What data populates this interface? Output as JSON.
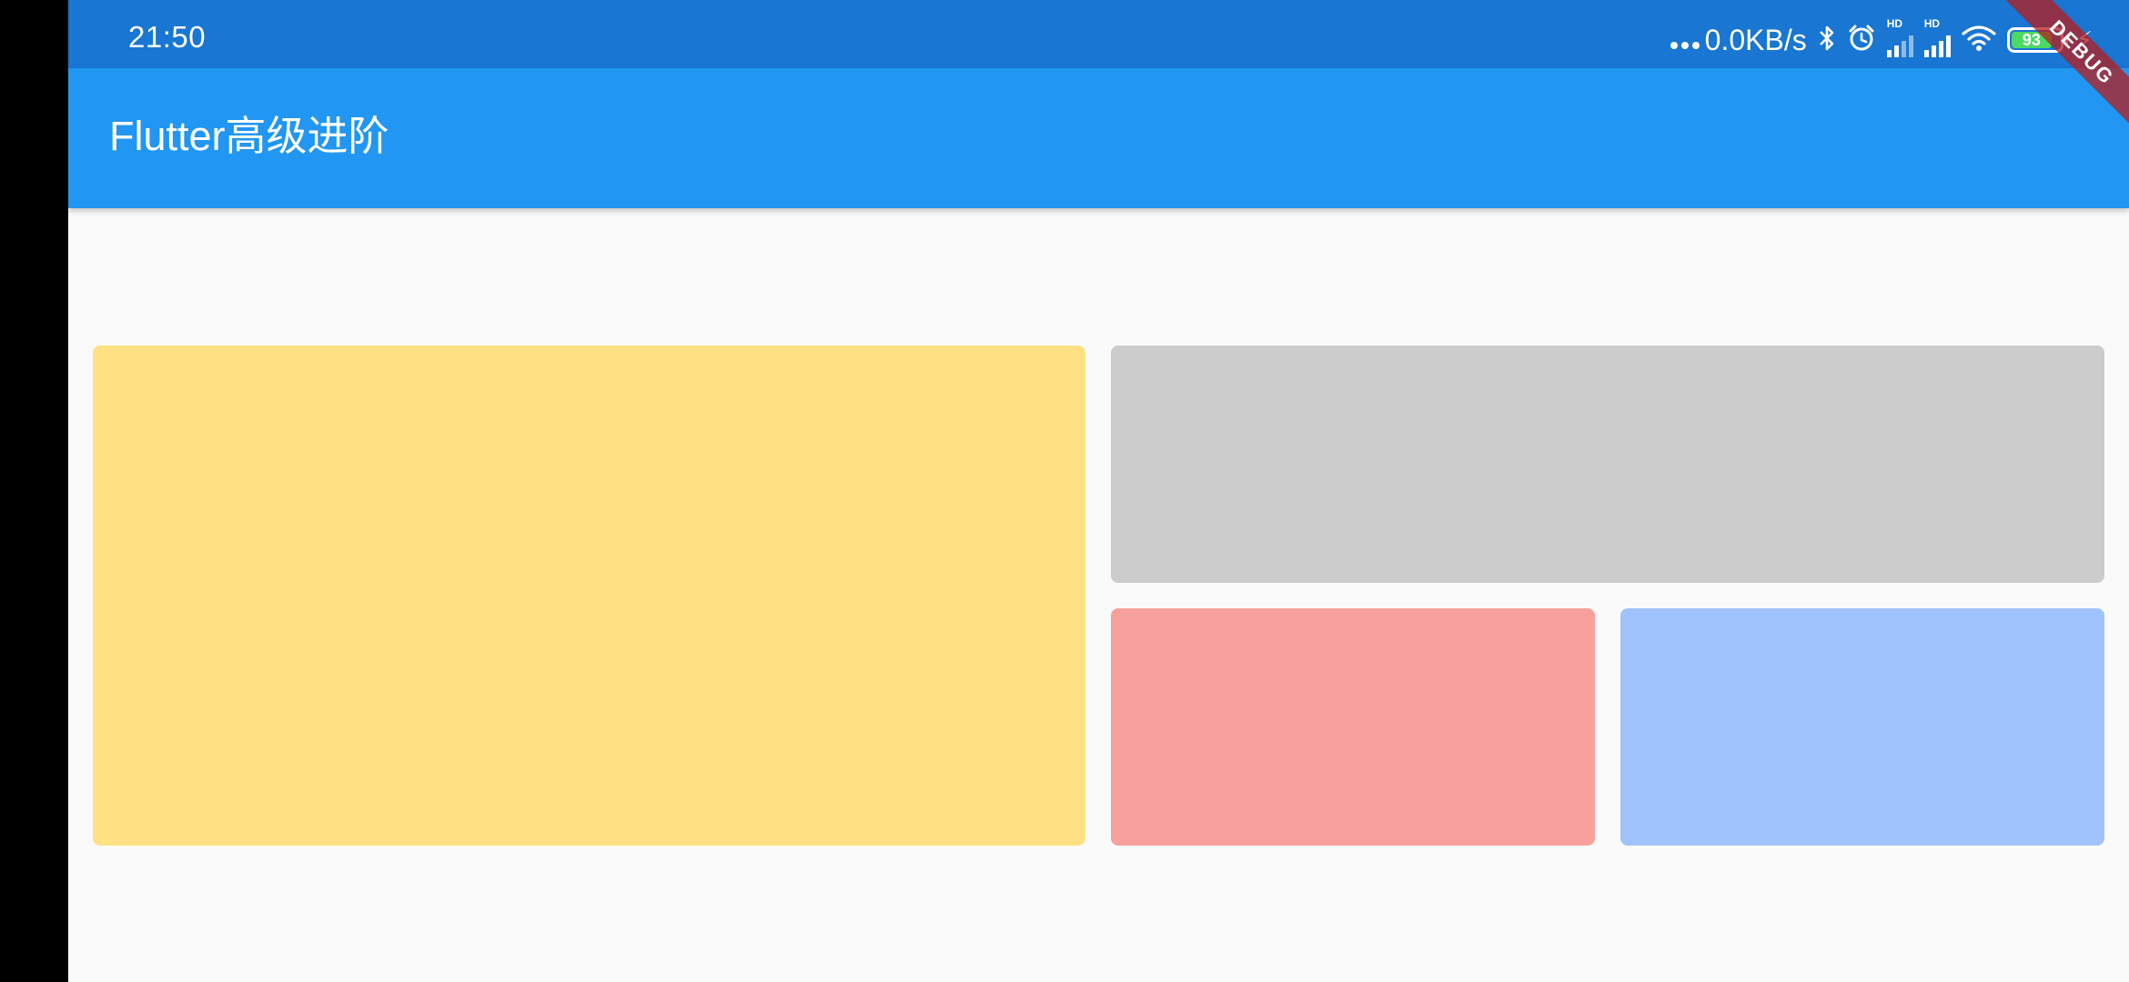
{
  "status_bar": {
    "time": "21:50",
    "network_speed": "0.0KB/s",
    "sim1_label": "HD",
    "sim2_label": "HD",
    "battery_level": "93",
    "icons": [
      "bluetooth-icon",
      "alarm-icon",
      "signal-icon",
      "signal-icon",
      "wifi-icon",
      "battery-icon",
      "charging-icon"
    ],
    "color": "#1976d2"
  },
  "app_bar": {
    "title": "Flutter高级进阶",
    "color": "#2196f3"
  },
  "debug_banner": {
    "label": "DEBUG"
  },
  "tiles": [
    {
      "name": "yellow",
      "color": "#ffe082"
    },
    {
      "name": "grey",
      "color": "#cccccc"
    },
    {
      "name": "red",
      "color": "#f8a19c"
    },
    {
      "name": "blue",
      "color": "#a0c3fe"
    }
  ]
}
